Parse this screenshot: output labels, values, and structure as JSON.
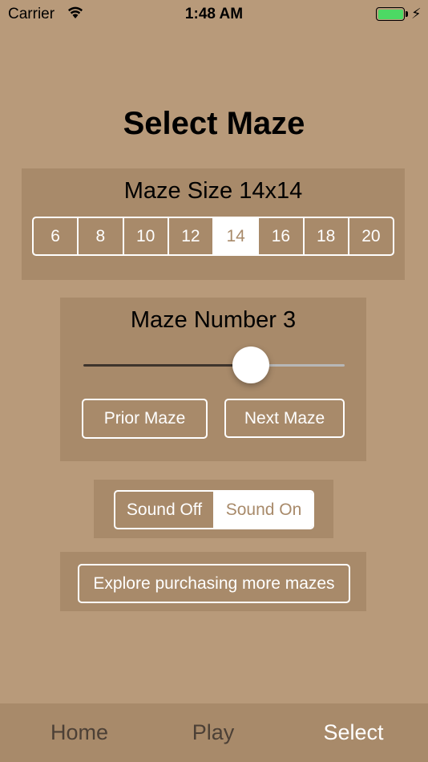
{
  "status_bar": {
    "carrier": "Carrier",
    "time": "1:48 AM"
  },
  "title": "Select Maze",
  "maze_size": {
    "label": "Maze Size 14x14",
    "options": [
      "6",
      "8",
      "10",
      "12",
      "14",
      "16",
      "18",
      "20"
    ],
    "selected": "14"
  },
  "maze_number": {
    "label": "Maze Number 3",
    "slider_value": 0.64,
    "prior_label": "Prior Maze",
    "next_label": "Next Maze"
  },
  "sound": {
    "options": [
      "Sound Off",
      "Sound On"
    ],
    "selected": "Sound On"
  },
  "explore_label": "Explore purchasing more mazes",
  "tabs": [
    {
      "label": "Home",
      "active": false
    },
    {
      "label": "Play",
      "active": false
    },
    {
      "label": "Select",
      "active": true
    }
  ],
  "colors": {
    "background": "#b89a7a",
    "panel": "#a88a6a",
    "accent": "#ffffff",
    "battery": "#4cd964"
  }
}
